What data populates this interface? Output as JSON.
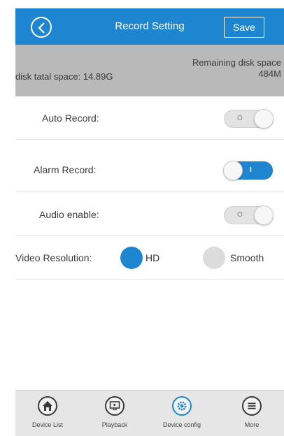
{
  "header": {
    "title": "Record Setting",
    "save_label": "Save",
    "back_icon": "back-circle-icon"
  },
  "disk": {
    "total_text": "disk tatal space: 14.89G",
    "remaining_line1": "Remaining disk space",
    "remaining_line2": "484M"
  },
  "settings": {
    "auto_record": {
      "label": "Auto Record:",
      "state": "off",
      "mark": "O"
    },
    "alarm_record": {
      "label": "Alarm Record:",
      "state": "on",
      "mark": "I"
    },
    "audio_enable": {
      "label": "Audio enable:",
      "state": "off",
      "mark": "O"
    }
  },
  "resolution": {
    "label": "Video Resolution:",
    "options": [
      {
        "label": "HD",
        "selected": true
      },
      {
        "label": "Smooth",
        "selected": false
      }
    ]
  },
  "tabbar": {
    "items": [
      {
        "label": "Device List",
        "icon": "home-icon",
        "active": false
      },
      {
        "label": "Playback",
        "icon": "monitor-icon",
        "active": false
      },
      {
        "label": "Device config",
        "icon": "gear-icon",
        "active": true
      },
      {
        "label": "More",
        "icon": "menu-icon",
        "active": false
      }
    ]
  },
  "colors": {
    "accent": "#1e86d0",
    "disk_bar": "#b9b9b9",
    "tabbar": "#e6e6e6"
  }
}
